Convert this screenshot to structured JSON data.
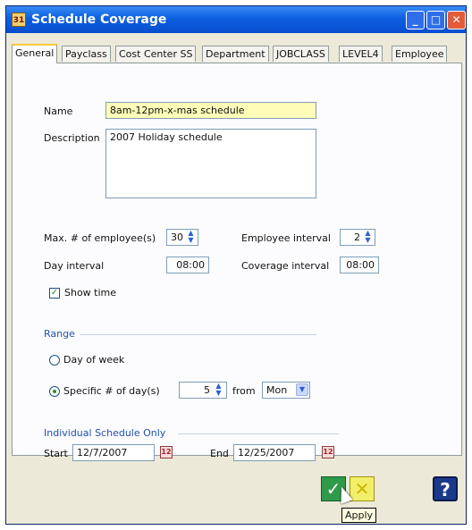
{
  "window": {
    "title": "Schedule Coverage",
    "icon_text": "31"
  },
  "tabs": [
    {
      "label": "General"
    },
    {
      "label": "Payclass"
    },
    {
      "label": "Cost Center SS"
    },
    {
      "label": "Department"
    },
    {
      "label": "JOBCLASS"
    },
    {
      "label": "LEVEL4"
    },
    {
      "label": "Employee"
    }
  ],
  "form": {
    "name_label": "Name",
    "name_value": "8am-12pm-x-mas schedule",
    "description_label": "Description",
    "description_value": "2007 Holiday schedule",
    "max_employees_label": "Max. # of employee(s)",
    "max_employees_value": "30",
    "employee_interval_label": "Employee interval",
    "employee_interval_value": "2",
    "day_interval_label": "Day interval",
    "day_interval_value": "08:00",
    "coverage_interval_label": "Coverage interval",
    "coverage_interval_value": "08:00",
    "show_time_label": "Show time",
    "show_time_checked": true
  },
  "range": {
    "section_label": "Range",
    "day_of_week_label": "Day of week",
    "specific_days_label": "Specific # of day(s)",
    "specific_days_value": "5",
    "from_label": "from",
    "from_value": "Mon",
    "selected": "specific_days"
  },
  "individual": {
    "section_label": "Individual Schedule Only",
    "start_label": "Start",
    "start_value": "12/7/2007",
    "end_label": "End",
    "end_value": "12/25/2007"
  },
  "buttons": {
    "tooltip": "Apply",
    "help_symbol": "?"
  },
  "colors": {
    "title_bar": "#0a4fcf",
    "accent_yellow": "#ffc83c",
    "section_text": "#2050b0"
  }
}
